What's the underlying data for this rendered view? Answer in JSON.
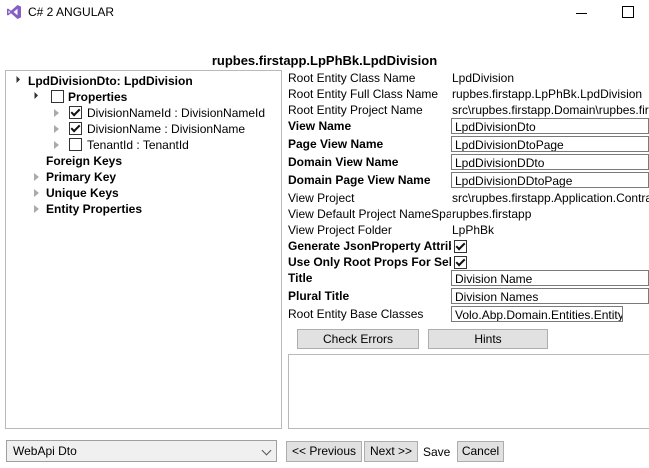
{
  "window": {
    "title": "C# 2 ANGULAR"
  },
  "heading": "rupbes.firstapp.LpPhBk.LpdDivision",
  "tree": {
    "root": "LpdDivisionDto: LpdDivision",
    "properties_label": "Properties",
    "items": [
      {
        "label": "DivisionNameId : DivisionNameId",
        "checked": true
      },
      {
        "label": "DivisionName : DivisionName",
        "checked": true
      },
      {
        "label": "TenantId : TenantId",
        "checked": false
      }
    ],
    "foreign_keys": "Foreign Keys",
    "primary_key": "Primary Key",
    "unique_keys": "Unique Keys",
    "entity_properties": "Entity Properties"
  },
  "props": {
    "root_entity_class_name": {
      "label": "Root Entity Class Name",
      "value": "LpdDivision"
    },
    "root_entity_full_class_name": {
      "label": "Root Entity Full Class Name",
      "value": "rupbes.firstapp.LpPhBk.LpdDivision"
    },
    "root_entity_project_name": {
      "label": "Root Entity Project Name",
      "value": "src\\rupbes.firstapp.Domain\\rupbes.firstapp"
    },
    "view_name": {
      "label": "View Name",
      "value": "LpdDivisionDto"
    },
    "page_view_name": {
      "label": "Page View Name",
      "value": "LpdDivisionDtoPage"
    },
    "domain_view_name": {
      "label": "Domain View Name",
      "value": "LpdDivisionDDto"
    },
    "domain_page_view_name": {
      "label": "Domain Page View Name",
      "value": "LpdDivisionDDtoPage"
    },
    "view_project": {
      "label": "View Project",
      "value": "src\\rupbes.firstapp.Application.Contracts"
    },
    "view_default_project_namespace": {
      "label": "View Default Project NameSpace",
      "value": "rupbes.firstapp"
    },
    "view_project_folder": {
      "label": "View Project Folder",
      "value": "LpPhBk"
    },
    "generate_jsonproperty": {
      "label": "Generate JsonProperty Attribute",
      "checked": true
    },
    "use_only_root_props": {
      "label": "Use Only Root Props For Select",
      "checked": true
    },
    "title": {
      "label": "Title",
      "value": "Division Name"
    },
    "plural_title": {
      "label": "Plural Title",
      "value": "Division Names"
    },
    "root_entity_base_classes": {
      "label": "Root Entity Base Classes",
      "value": "Volo.Abp.Domain.Entities.Entity"
    }
  },
  "buttons": {
    "check_errors": "Check Errors",
    "hints": "Hints",
    "previous": "<< Previous",
    "next": "Next >>",
    "save": "Save",
    "cancel": "Cancel"
  },
  "dropdown": {
    "selected": "WebApi Dto"
  },
  "icons": {
    "app": "visual-studio-icon"
  },
  "colors": {
    "vs_purple": "#865fc5",
    "button_bg": "#e1e1e1"
  }
}
